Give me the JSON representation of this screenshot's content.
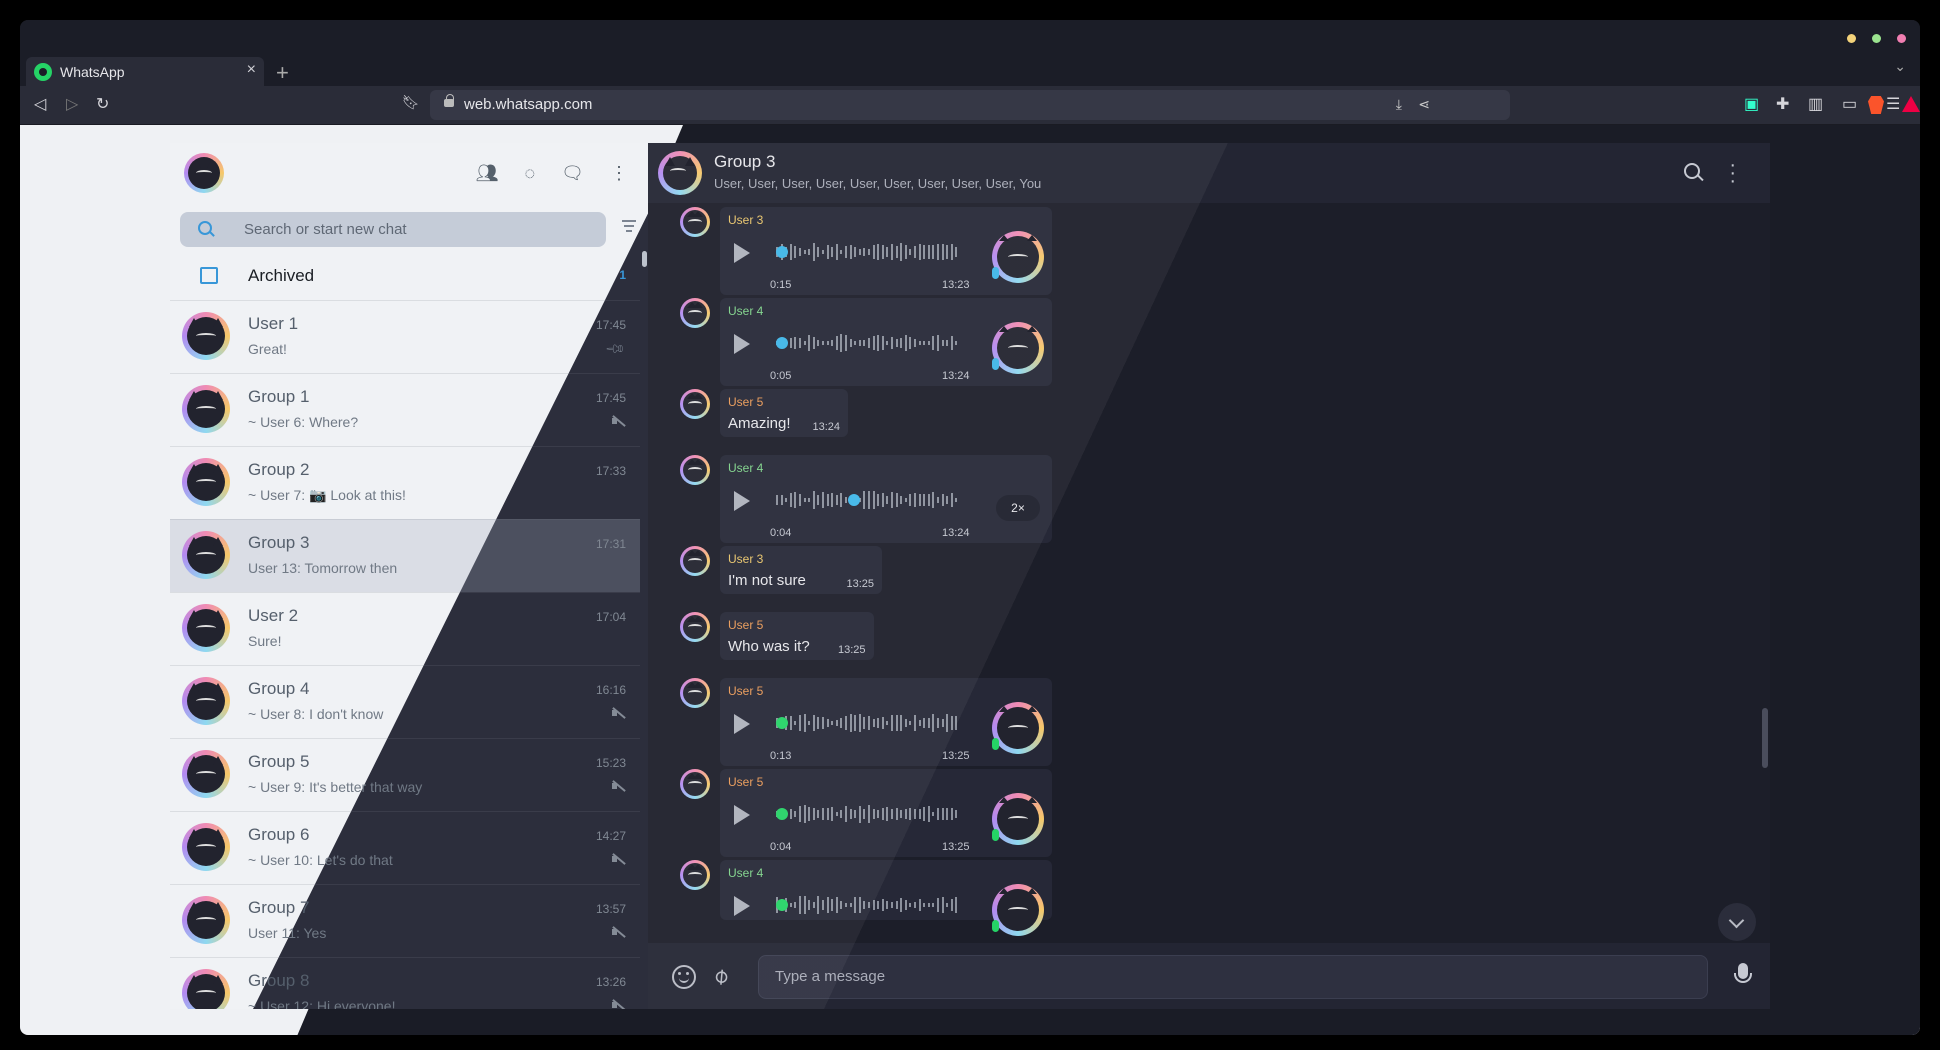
{
  "browser": {
    "tab_title": "WhatsApp",
    "tab_close": "×",
    "new_tab": "+",
    "url": "web.whatsapp.com",
    "window_dots": [
      "#f3d27a",
      "#9be38f",
      "#f07eb1"
    ]
  },
  "sidebar": {
    "search_placeholder": "Search or start new chat",
    "archived_label": "Archived",
    "archived_count": "1",
    "chats": [
      {
        "name": "User 1",
        "preview": "Great!",
        "time": "17:45",
        "badge": "pin-icon"
      },
      {
        "name": "Group 1",
        "preview": "~ User 6: Where?",
        "time": "17:45",
        "badge": "mute-icon"
      },
      {
        "name": "Group 2",
        "preview": "~ User 7: 📷 Look at this!",
        "time": "17:33",
        "badge": "none"
      },
      {
        "name": "Group 3",
        "preview": "User 13: Tomorrow then",
        "time": "17:31",
        "badge": "none",
        "active": true
      },
      {
        "name": "User 2",
        "preview": "Sure!",
        "time": "17:04",
        "badge": "none"
      },
      {
        "name": "Group 4",
        "preview": "~ User 8: I don't know",
        "time": "16:16",
        "badge": "mute-icon"
      },
      {
        "name": "Group 5",
        "preview": "~ User 9: It's better that way",
        "time": "15:23",
        "badge": "mute-icon"
      },
      {
        "name": "Group 6",
        "preview": "~ User 10: Let's do that",
        "time": "14:27",
        "badge": "mute-icon"
      },
      {
        "name": "Group 7",
        "preview": "User 11: Yes",
        "time": "13:57",
        "badge": "mute-icon"
      },
      {
        "name": "Group 8",
        "preview": "~ User 12: Hi everyone!",
        "time": "13:26",
        "badge": "mute-icon"
      }
    ]
  },
  "conversation": {
    "title": "Group 3",
    "members": "User, User, User, User, User, User, User, User, User, You",
    "messages": [
      {
        "sender": "User 3",
        "type": "voice",
        "duration": "0:15",
        "time": "13:23",
        "color": "#e8c46a",
        "knob": "#3fb6e8",
        "progress": 0.0
      },
      {
        "sender": "User 4",
        "type": "voice",
        "duration": "0:05",
        "time": "13:24",
        "color": "#7fd38a",
        "knob": "#3fb6e8",
        "progress": 0.0
      },
      {
        "sender": "User 5",
        "type": "text",
        "text": "Amazing!",
        "time": "13:24",
        "color": "#e99a57"
      },
      {
        "sender": "User 4",
        "type": "voice",
        "duration": "0:04",
        "time": "13:24",
        "color": "#7fd38a",
        "knob": "#3fb6e8",
        "progress": 0.4,
        "speed": "2×"
      },
      {
        "sender": "User 3",
        "type": "text",
        "text": "I'm not sure",
        "time": "13:25",
        "color": "#e8c46a"
      },
      {
        "sender": "User 5",
        "type": "text",
        "text": "Who was it?",
        "time": "13:25",
        "color": "#e99a57"
      },
      {
        "sender": "User 5",
        "type": "voice",
        "duration": "0:13",
        "time": "13:25",
        "color": "#e99a57",
        "knob": "#25d366",
        "progress": 0.0
      },
      {
        "sender": "User 5",
        "type": "voice",
        "duration": "0:04",
        "time": "13:25",
        "color": "#e99a57",
        "knob": "#25d366",
        "progress": 0.0
      },
      {
        "sender": "User 4",
        "type": "voice",
        "duration": "",
        "time": "",
        "color": "#7fd38a",
        "knob": "#25d366",
        "progress": 0.0
      }
    ],
    "composer_placeholder": "Type a message"
  }
}
